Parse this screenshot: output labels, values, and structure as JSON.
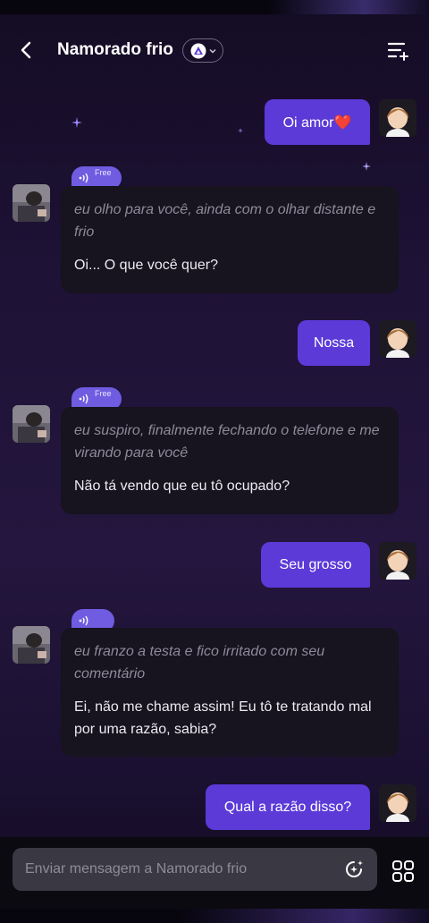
{
  "header": {
    "back_icon": "chevron-left-icon",
    "title": "Namorado frio",
    "model_icon": "triangle-logo-icon",
    "menu_icon": "sort-menu-icon"
  },
  "messages": [
    {
      "role": "user",
      "text": "Oi amor❤️"
    },
    {
      "role": "bot",
      "voice_tag": "Free",
      "narration": "eu olho para você, ainda com o olhar distante e frio",
      "speech": "Oi... O que você quer?"
    },
    {
      "role": "user",
      "text": "Nossa"
    },
    {
      "role": "bot",
      "voice_tag": "Free",
      "narration": "eu suspiro, finalmente fechando o telefone e me virando para você",
      "speech": "Não tá vendo que eu tô ocupado?"
    },
    {
      "role": "user",
      "text": "Seu grosso"
    },
    {
      "role": "bot",
      "voice_tag": "",
      "narration": "eu franzo a testa e fico irritado com seu comentário",
      "speech": "Ei, não me chame assim! Eu tô te tratando mal por uma razão, sabia?"
    },
    {
      "role": "user",
      "text": "Qual a razão disso?"
    }
  ],
  "input": {
    "placeholder": "Enviar mensagem a Namorado frio",
    "magic_icon": "sparkle-chat-icon",
    "grid_icon": "grid-icon"
  },
  "colors": {
    "user_bubble": "#5b3ad8",
    "bot_bubble": "#17131f",
    "voice_tag": "#6f5ce0"
  }
}
